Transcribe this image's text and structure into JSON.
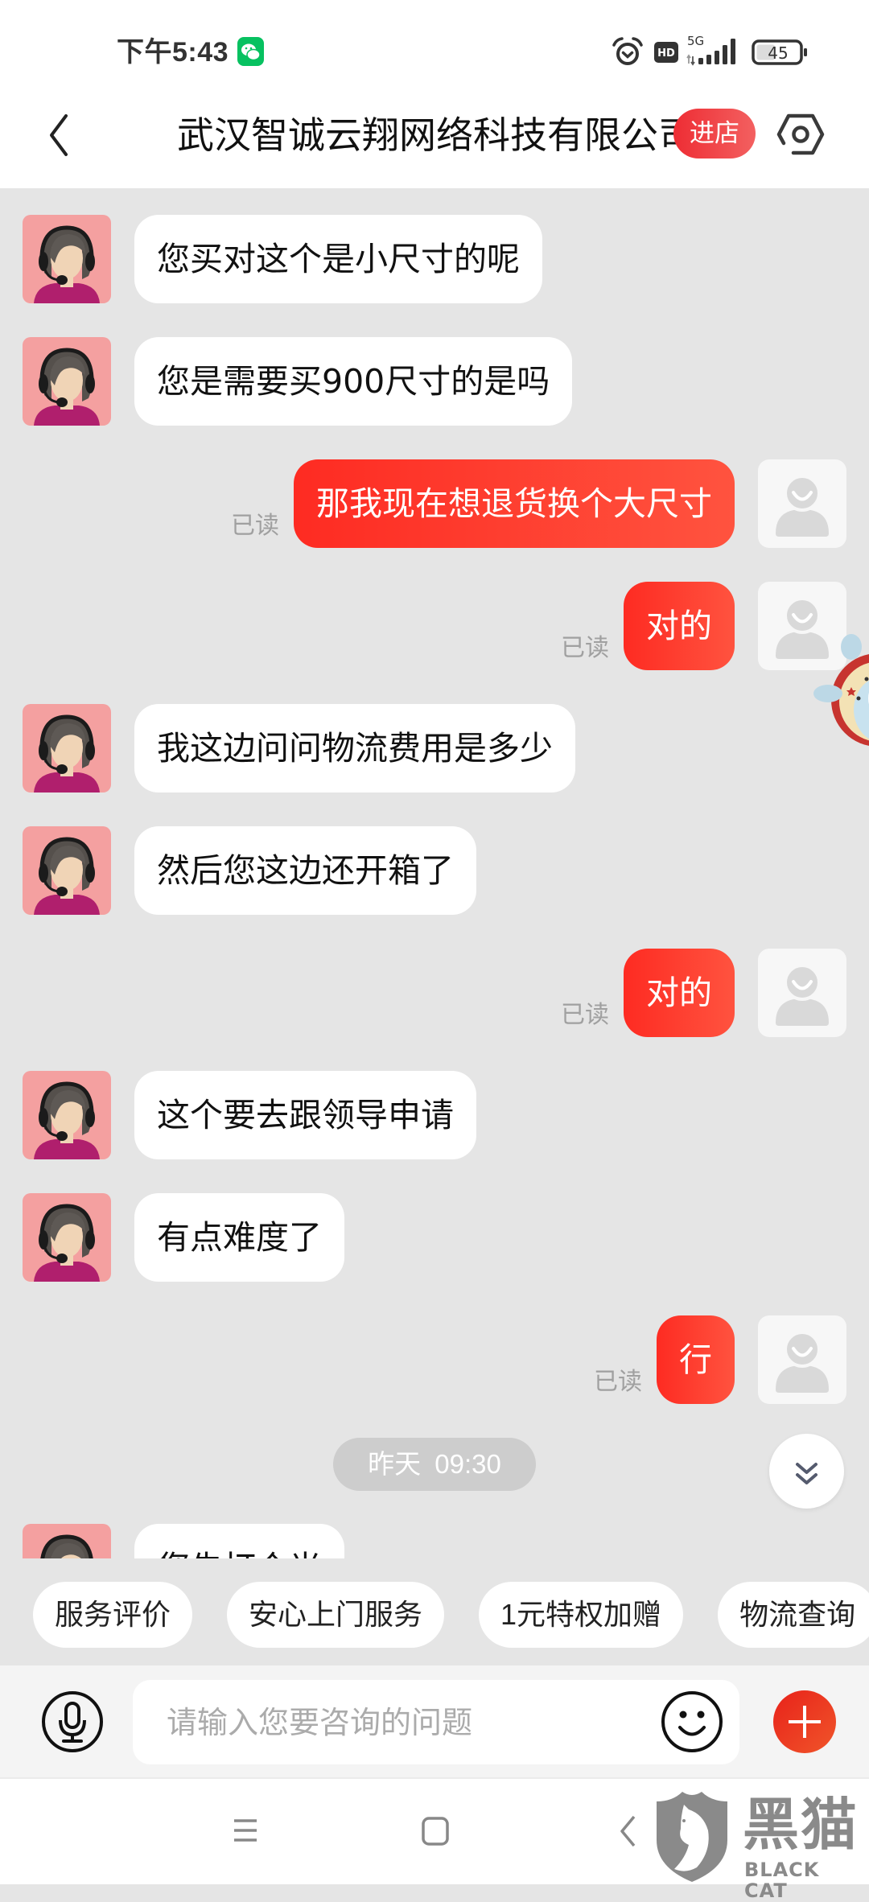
{
  "status_bar": {
    "time": "下午5:43",
    "notification_icon": "wechat-icon",
    "icons": [
      "alarm-icon",
      "hd-icon",
      "5g-signal-icon",
      "battery-icon"
    ],
    "network_label": "5G",
    "hd_label": "HD",
    "battery_level": 45,
    "battery_label": "45"
  },
  "header": {
    "back_icon": "chevron-left-icon",
    "title": "武汉智诚云翔网络科技有限公司",
    "store_button": "进店",
    "settings_icon": "hexagon-settings-icon"
  },
  "chat": {
    "items": [
      {
        "type": "message",
        "sender": "agent",
        "text": "您买对这个是小尺寸的呢"
      },
      {
        "type": "message",
        "sender": "agent",
        "text": "您是需要买900尺寸的是吗"
      },
      {
        "type": "message",
        "sender": "user",
        "text": "那我现在想退货换个大尺寸",
        "status": "已读"
      },
      {
        "type": "message",
        "sender": "user",
        "text": "对的",
        "status": "已读"
      },
      {
        "type": "message",
        "sender": "agent",
        "text": "我这边问问物流费用是多少"
      },
      {
        "type": "message",
        "sender": "agent",
        "text": "然后您这边还开箱了"
      },
      {
        "type": "message",
        "sender": "user",
        "text": "对的",
        "status": "已读"
      },
      {
        "type": "message",
        "sender": "agent",
        "text": "这个要去跟领导申请"
      },
      {
        "type": "message",
        "sender": "agent",
        "text": "有点难度了"
      },
      {
        "type": "message",
        "sender": "user",
        "text": "行",
        "status": "已读"
      },
      {
        "type": "time",
        "text": "昨天 09:30"
      },
      {
        "type": "message",
        "sender": "agent",
        "text": "您先打个光",
        "partial": true
      }
    ],
    "scroll_down_icon": "double-chevron-down-icon"
  },
  "quick_replies": [
    "服务评价",
    "安心上门服务",
    "1元特权加赠",
    "物流查询"
  ],
  "input": {
    "voice_icon": "microphone-icon",
    "placeholder": "请输入您要咨询的问题",
    "value": "",
    "emoji_icon": "smiley-icon",
    "more_icon": "plus-icon"
  },
  "nav": {
    "icons": [
      "menu-icon",
      "home-icon",
      "back-icon"
    ]
  },
  "watermark": {
    "cn": "黑猫",
    "en": "BLACK CAT"
  },
  "colors": {
    "accent": "#fe2b22",
    "accent_end": "#ff533f",
    "chat_background": "#e5e5e5",
    "agent_bubble": "#ffffff",
    "read_status": "#a0a0a0",
    "wechat_green": "#07c160"
  }
}
